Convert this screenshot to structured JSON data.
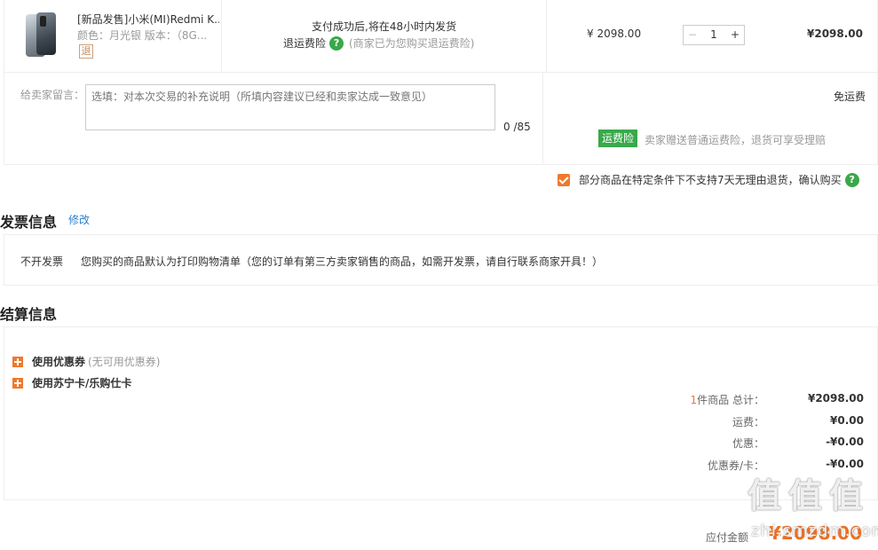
{
  "product": {
    "name": "[新品发售]小米(MI)Redmi K...",
    "spec": "颜色：月光银   版本：（8G...",
    "return_badge": "退",
    "ship_note": "支付成功后,将在48小时内发货",
    "return_insurance_label": "退运费险",
    "return_insurance_icon": "question-icon",
    "return_insurance_note": "(商家已为您购买退运费险)",
    "unit_price": "¥ 2098.00",
    "qty_minus": "−",
    "qty_value": "1",
    "qty_plus": "+",
    "subtotal": "¥2098.00"
  },
  "message": {
    "label": "给卖家留言：",
    "placeholder": "选填：对本次交易的补充说明（所填内容建议已经和卖家达成一致意见）",
    "count": "0 /85",
    "free_shipping": "免运费",
    "insurance_tag": "运费险",
    "insurance_note": "卖家赠送普通运费险，退货可享受理赔"
  },
  "confirm": {
    "text": "部分商品在特定条件下不支持7天无理由退货，确认购买",
    "checked": true
  },
  "invoice": {
    "title": "发票信息",
    "edit": "修改",
    "type": "不开发票",
    "note": "您购买的商品默认为打印购物清单（您的订单有第三方卖家销售的商品，如需开发票，请自行联系商家开具！）"
  },
  "settlement": {
    "title": "结算信息",
    "coupon_label": "使用优惠券",
    "coupon_hint": "(无可用优惠券)",
    "card_label": "使用苏宁卡/乐购仕卡",
    "count_num": "1",
    "count_suffix": "件商品 总计：",
    "total": "¥2098.00",
    "freight_label": "运费：",
    "freight": "¥0.00",
    "discount_label": "优惠：",
    "discount": "-¥0.00",
    "coupon_card_label": "优惠券/卡：",
    "coupon_card": "-¥0.00",
    "payable_label": "应付金额",
    "payable": "¥2098.00"
  },
  "watermark": {
    "glyph": "值",
    "text": "zhi.smzdm.com"
  },
  "colors": {
    "accent_orange": "#f0782d",
    "green": "#39a94a",
    "link_blue": "#2c7fd0"
  }
}
